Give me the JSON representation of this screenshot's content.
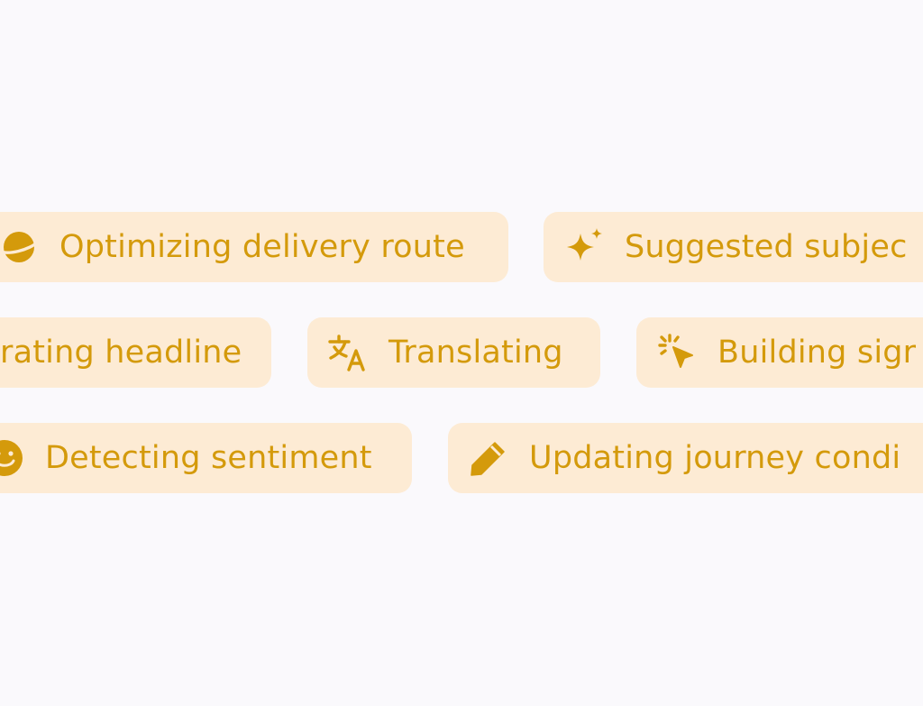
{
  "chip_colors": {
    "background": "#fdebd4",
    "foreground": "#d49a0b",
    "page_background": "#faf9fc"
  },
  "rows": [
    {
      "chips": [
        {
          "icon": "planet-icon",
          "label": "Optimizing delivery route"
        },
        {
          "icon": "sparkles-icon",
          "label": "Suggested subjec"
        }
      ]
    },
    {
      "chips": [
        {
          "icon": "",
          "label": "rating headline"
        },
        {
          "icon": "translate-icon",
          "label": "Translating"
        },
        {
          "icon": "cursor-click-icon",
          "label": "Building sigr"
        }
      ]
    },
    {
      "chips": [
        {
          "icon": "smiley-icon",
          "label": "Detecting sentiment"
        },
        {
          "icon": "pencil-icon",
          "label": "Updating journey condi"
        }
      ]
    }
  ]
}
